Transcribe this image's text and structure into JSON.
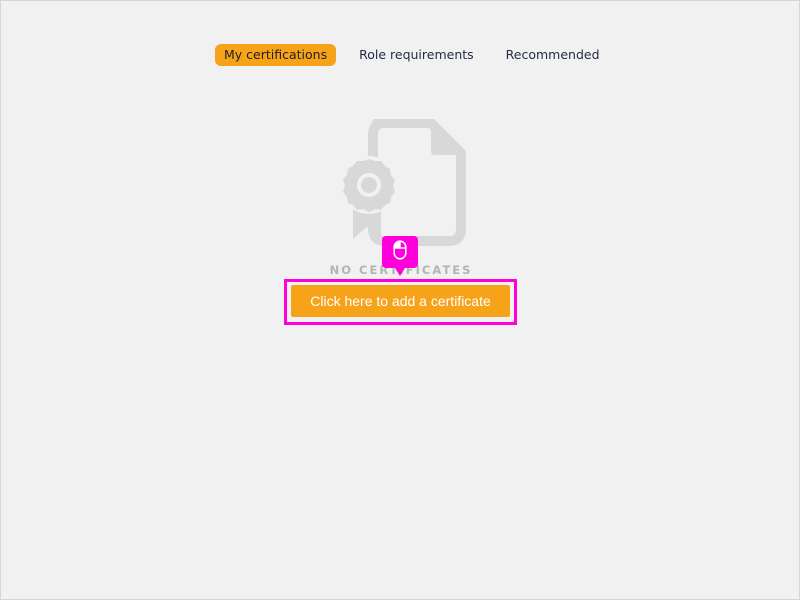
{
  "tabs": [
    {
      "label": "My certifications",
      "active": true
    },
    {
      "label": "Role requirements",
      "active": false
    },
    {
      "label": "Recommended",
      "active": false
    }
  ],
  "empty_state": {
    "icon": "certificate-document-icon",
    "message": "NO CERTIFICATES"
  },
  "actions": {
    "add_certificate_label": "Click here to add a certificate"
  },
  "overlay": {
    "click_marker_icon": "mouse-icon",
    "highlight_color": "#ff00dd"
  },
  "colors": {
    "accent": "#f7a319",
    "background": "#f1f1f1",
    "tab_text": "#1f2a44",
    "illustration": "#d8d8d8"
  }
}
